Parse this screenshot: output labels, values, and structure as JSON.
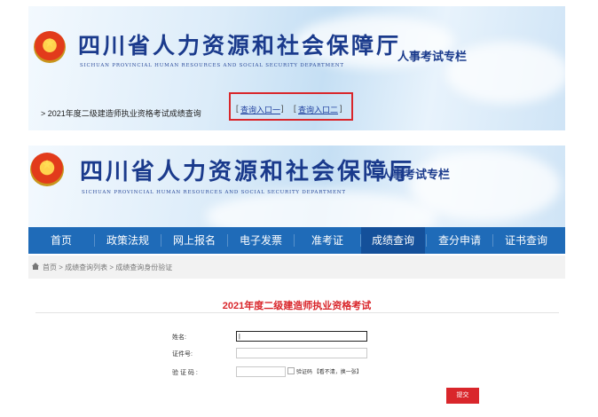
{
  "top_banner": {
    "org_name": "四川省人力资源和社会保障厅",
    "org_name_en": "SICHUAN PROVINCIAL HUMAN RESOURCES AND SOCIAL SECURITY DEPARTMENT",
    "column_title": "人事考试专栏",
    "notice": "> 2021年度二级建造师执业资格考试成绩查询",
    "links": [
      "查询入口一",
      "查询入口二"
    ]
  },
  "header": {
    "org_name": "四川省人力资源和社会保障厅",
    "org_name_en": "SICHUAN PROVINCIAL HUMAN RESOURCES AND SOCIAL SECURITY DEPARTMENT",
    "column_title": "人事考试专栏"
  },
  "nav": {
    "items": [
      "首页",
      "政策法规",
      "网上报名",
      "电子发票",
      "准考证",
      "成绩查询",
      "查分申请",
      "证书查询"
    ],
    "active": "成绩查询"
  },
  "breadcrumb": "首页 > 成绩查询列表 > 成绩查询身份验证",
  "form": {
    "title": "2021年度二级建造师执业资格考试",
    "name_label": "姓名:",
    "name_value": "|",
    "id_label": "证件号:",
    "captcha_label": "验 证 码 :",
    "captcha_alt": "验证码",
    "captcha_refresh": "【看不清，换一张】",
    "submit_label": "提交"
  },
  "colors": {
    "nav_bg": "#1f6bb8",
    "nav_active": "#14509a",
    "accent_red": "#d9262b",
    "title_blue": "#1a3a8c"
  }
}
